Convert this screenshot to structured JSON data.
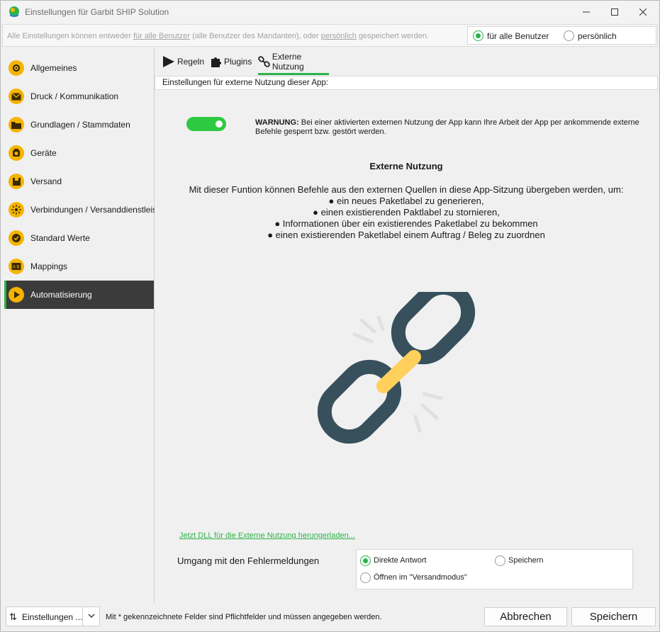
{
  "window": {
    "title": "Einstellungen für Garbit SHIP Solution",
    "controls": [
      "minimize-icon",
      "maximize-icon",
      "close-icon"
    ]
  },
  "infobar": {
    "text_before": "Alle Einstellungen können entweder ",
    "link_all": "für alle Benutzer",
    "text_middle": " (alle Benutzer des Mandanten), oder ",
    "link_personal": "persönlich",
    "text_after": " gespeichert werden.",
    "scope_options": [
      {
        "label": "für alle Benutzer",
        "selected": true
      },
      {
        "label": "persönlich",
        "selected": false
      }
    ]
  },
  "sidebar": {
    "items": [
      {
        "label": "Allgemeines",
        "icon": "gear-icon"
      },
      {
        "label": "Druck / Kommunikation",
        "icon": "envelope-icon"
      },
      {
        "label": "Grundlagen / Stammdaten",
        "icon": "folder-icon"
      },
      {
        "label": "Geräte",
        "icon": "scale-icon"
      },
      {
        "label": "Versand",
        "icon": "package-icon"
      },
      {
        "label": "Verbindungen / Versanddienstleister",
        "icon": "connection-icon"
      },
      {
        "label": "Standard Werte",
        "icon": "check-icon"
      },
      {
        "label": "Mappings",
        "icon": "mapping-icon"
      },
      {
        "label": "Automatisierung",
        "icon": "play-icon",
        "active": true
      }
    ]
  },
  "tabs": [
    {
      "label": "Regeln",
      "icon": "play-icon"
    },
    {
      "label": "Plugins",
      "icon": "puzzle-icon"
    },
    {
      "label": "Externe Nutzung",
      "icon": "link-icon",
      "active": true
    }
  ],
  "section": {
    "header": "Einstellungen für externe Nutzung dieser App:"
  },
  "external": {
    "toggle_on": true,
    "warning_label": "WARNUNG:",
    "warning_text": " Bei einer aktivierten externen Nutzung der App kann Ihre Arbeit der App per ankommende externe Befehle gesperrt bzw. gestört werden.",
    "title": "Externe Nutzung",
    "intro": "Mit dieser Funtion können Befehle aus den externen Quellen in diese App-Sitzung übergeben werden, um:",
    "bullets": [
      "● ein neues Paketlabel zu generieren,",
      "● einen existierenden Paktlabel zu stornieren,",
      "● Informationen über ein existierendes Paketlabel zu bekommen",
      "● einen existierenden Paketlabel einem Auftrag / Beleg zu zuordnen"
    ],
    "download_link": "Jetzt DLL für die Externe Nutzung herungerladen...",
    "error_label": "Umgang mit den Fehlermeldungen",
    "error_options": [
      {
        "label": "Direkte Antwort",
        "selected": true
      },
      {
        "label": "Speichern",
        "selected": false
      },
      {
        "label": "Öffnen im \"Versandmodus\"",
        "selected": false
      }
    ]
  },
  "colors": {
    "accent": "#2db34a",
    "icon_yellow": "#f5b400",
    "chain_dark": "#37505c",
    "chain_yellow": "#ffd05b",
    "active_bg": "#3b3b3b"
  },
  "footer": {
    "dropdown": "Einstellungen ...",
    "note": "Mit * gekennzeichnete Felder sind Pflichtfelder und müssen angegeben werden.",
    "cancel": "Abbrechen",
    "save": "Speichern"
  }
}
